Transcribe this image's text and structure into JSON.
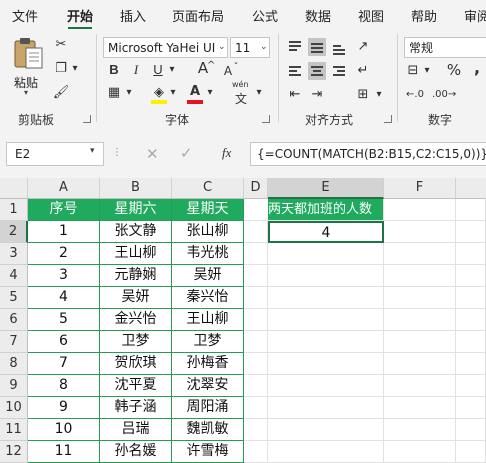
{
  "tabs": [
    {
      "label": "文件",
      "active": false
    },
    {
      "label": "开始",
      "active": true
    },
    {
      "label": "插入",
      "active": false
    },
    {
      "label": "页面布局",
      "active": false
    },
    {
      "label": "公式",
      "active": false
    },
    {
      "label": "数据",
      "active": false
    },
    {
      "label": "视图",
      "active": false
    },
    {
      "label": "帮助",
      "active": false
    },
    {
      "label": "审阅",
      "active": false
    }
  ],
  "ribbon": {
    "clipboard": {
      "group_label": "剪贴板",
      "paste_label": "粘贴"
    },
    "font": {
      "group_label": "字体",
      "font_name": "Microsoft YaHei UI",
      "font_size": "11",
      "bold": "B",
      "italic": "I",
      "underline": "U",
      "grow": "A",
      "shrink": "A",
      "phonetic": "wén"
    },
    "alignment": {
      "group_label": "对齐方式"
    },
    "number": {
      "group_label": "数字",
      "format": "常规",
      "percent": "%",
      "comma": ","
    }
  },
  "formula_bar": {
    "name_box": "E2",
    "fx": "fx",
    "formula": "{=COUNT(MATCH(B2:B15,C2:C15,0))}"
  },
  "sheet": {
    "columns": [
      "A",
      "B",
      "C",
      "D",
      "E",
      "F"
    ],
    "row_numbers": [
      "1",
      "2",
      "3",
      "4",
      "5",
      "6",
      "7",
      "8",
      "9",
      "10",
      "11",
      "12"
    ],
    "headers": [
      "序号",
      "星期六",
      "星期天"
    ],
    "rows": [
      [
        "1",
        "张文静",
        "张山柳"
      ],
      [
        "2",
        "王山柳",
        "韦光桃"
      ],
      [
        "3",
        "元静娴",
        "吴妍"
      ],
      [
        "4",
        "吴妍",
        "秦兴怡"
      ],
      [
        "5",
        "金兴怡",
        "王山柳"
      ],
      [
        "6",
        "卫梦",
        "卫梦"
      ],
      [
        "7",
        "贺欣琪",
        "孙梅香"
      ],
      [
        "8",
        "沈平夏",
        "沈翠安"
      ],
      [
        "9",
        "韩子涵",
        "周阳涌"
      ],
      [
        "10",
        "吕瑞",
        "魏凯敏"
      ],
      [
        "11",
        "孙名媛",
        "许雪梅"
      ]
    ],
    "e_header": "两天都加班的人数",
    "e_value": "4"
  },
  "colors": {
    "accent": "#217346",
    "header_fill": "#1faa5e"
  }
}
